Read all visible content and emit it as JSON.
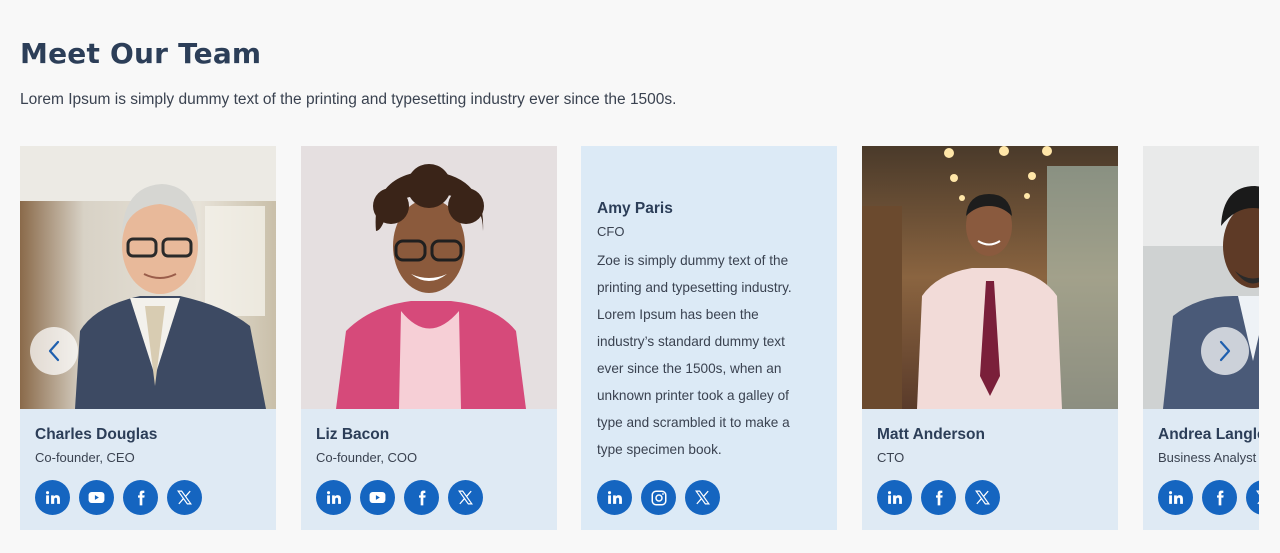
{
  "header": {
    "title": "Meet Our Team",
    "subtitle": "Lorem Ipsum is simply dummy text of the printing and typesetting industry ever since the 1500s."
  },
  "colors": {
    "accent": "#1565c0",
    "card_bg": "#dfeaf4",
    "heading": "#2c3e58"
  },
  "carousel": {
    "prev_icon": "chevron-left-icon",
    "next_icon": "chevron-right-icon",
    "cards": [
      {
        "name": "Charles Douglas",
        "role": "Co-founder, CEO",
        "socials": [
          "linkedin-icon",
          "youtube-icon",
          "facebook-icon",
          "x-icon"
        ]
      },
      {
        "name": "Liz Bacon",
        "role": "Co-founder, COO",
        "socials": [
          "linkedin-icon",
          "youtube-icon",
          "facebook-icon",
          "x-icon"
        ]
      },
      {
        "name": "Amy Paris",
        "role": "CFO",
        "bio": "Zoe is simply dummy text of the printing and typesetting industry. Lorem Ipsum has been the industry’s standard dummy text ever since the 1500s, when an unknown printer took a galley of type and scrambled it to make a type specimen book.",
        "socials": [
          "linkedin-icon",
          "instagram-icon",
          "x-icon"
        ]
      },
      {
        "name": "Matt Anderson",
        "role": "CTO",
        "socials": [
          "linkedin-icon",
          "facebook-icon",
          "x-icon"
        ]
      },
      {
        "name": "Andrea Langley",
        "role": "Business Analyst",
        "socials": [
          "linkedin-icon",
          "facebook-icon",
          "x-icon"
        ]
      }
    ]
  }
}
